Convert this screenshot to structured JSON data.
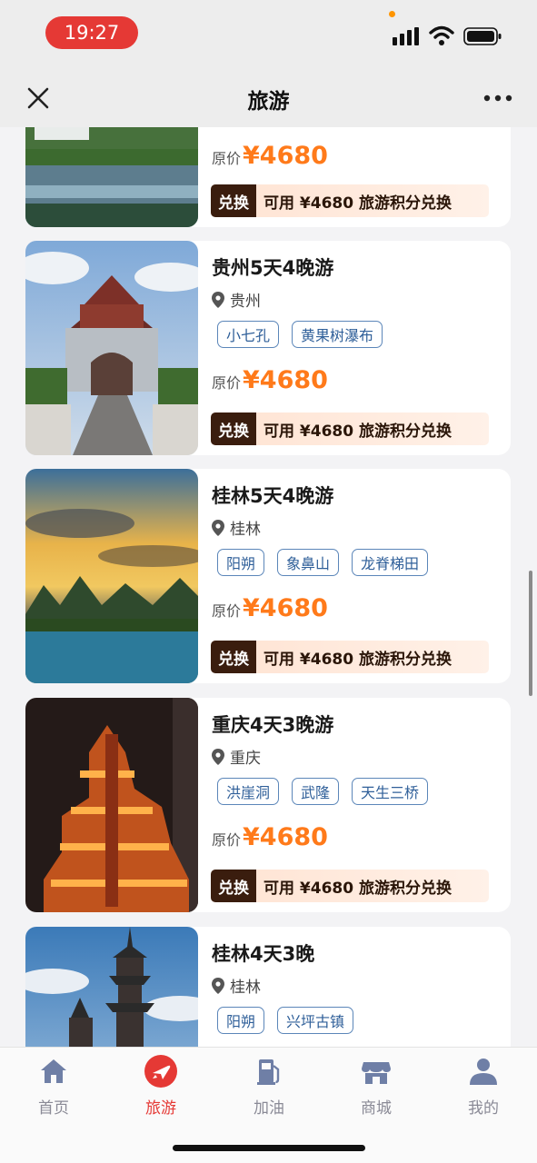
{
  "status_bar": {
    "time": "19:27"
  },
  "nav": {
    "title": "旅游"
  },
  "cards": [
    {
      "title": "",
      "location": "",
      "tags": [],
      "price_label": "原价",
      "price": "¥4680",
      "exchange_tag": "兑换",
      "exchange_text": "可用 ¥4680 旅游积分兑换"
    },
    {
      "title": "贵州5天4晚游",
      "location": "贵州",
      "tags": [
        "小七孔",
        "黄果树瀑布"
      ],
      "price_label": "原价",
      "price": "¥4680",
      "exchange_tag": "兑换",
      "exchange_text": "可用 ¥4680 旅游积分兑换"
    },
    {
      "title": "桂林5天4晚游",
      "location": "桂林",
      "tags": [
        "阳朔",
        "象鼻山",
        "龙脊梯田"
      ],
      "price_label": "原价",
      "price": "¥4680",
      "exchange_tag": "兑换",
      "exchange_text": "可用 ¥4680 旅游积分兑换"
    },
    {
      "title": "重庆4天3晚游",
      "location": "重庆",
      "tags": [
        "洪崖洞",
        "武隆",
        "天生三桥"
      ],
      "price_label": "原价",
      "price": "¥4680",
      "exchange_tag": "兑换",
      "exchange_text": "可用 ¥4680 旅游积分兑换"
    },
    {
      "title": "桂林4天3晚",
      "location": "桂林",
      "tags": [
        "阳朔",
        "兴坪古镇"
      ]
    }
  ],
  "tab_bar": {
    "active": "旅游",
    "items": [
      {
        "label": "首页",
        "icon": "home-icon"
      },
      {
        "label": "旅游",
        "icon": "plane-icon"
      },
      {
        "label": "加油",
        "icon": "fuel-pump-icon"
      },
      {
        "label": "商城",
        "icon": "store-icon"
      },
      {
        "label": "我的",
        "icon": "user-icon"
      }
    ]
  },
  "colors": {
    "accent": "#e53935",
    "price": "#ff7a1a",
    "tag_border": "#5b86b9",
    "exchange_tag_bg": "#3a1d0e"
  }
}
